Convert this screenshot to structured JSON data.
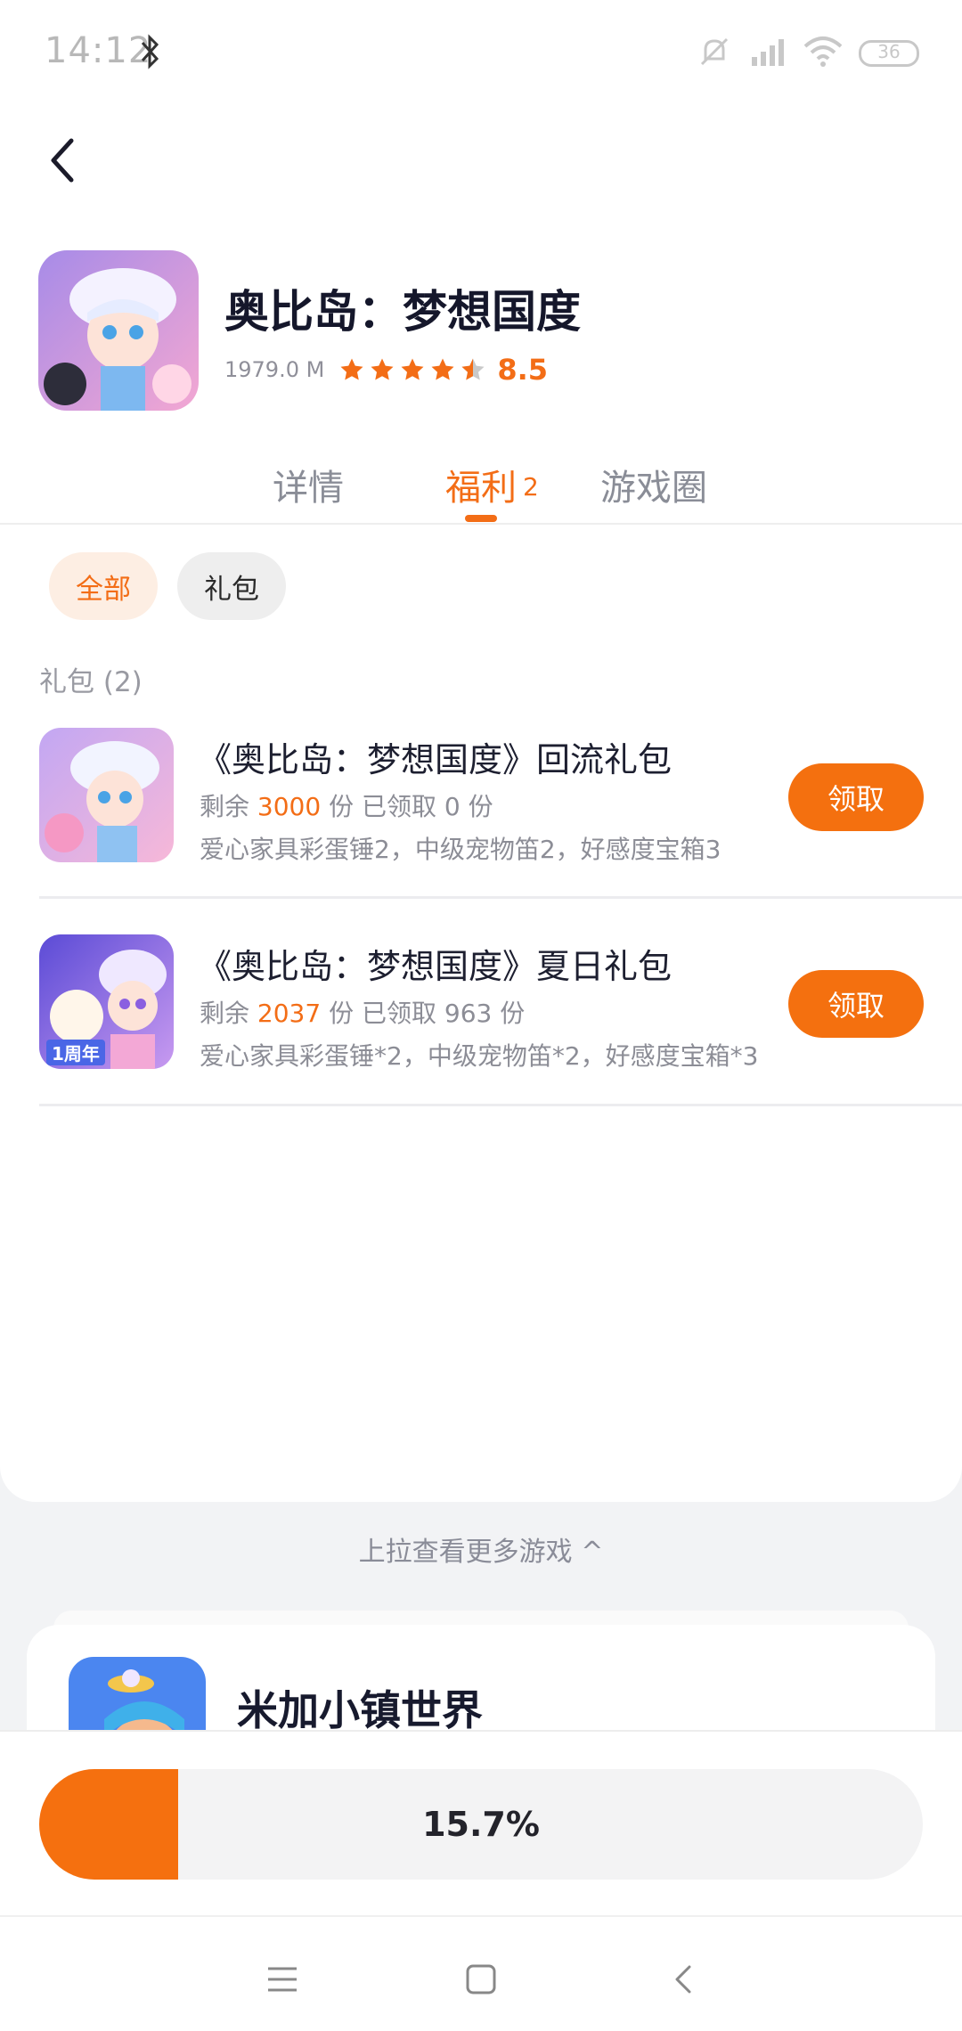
{
  "status_bar": {
    "time": "14:12",
    "battery": "36"
  },
  "app": {
    "title": "奥比岛：梦想国度",
    "size": "1979.0 M",
    "rating": "8.5",
    "stars": 4.5,
    "colors": {
      "accent": "#f36d16"
    }
  },
  "tabs": [
    {
      "label": "详情"
    },
    {
      "label": "福利",
      "count": "2"
    },
    {
      "label": "游戏圈"
    }
  ],
  "filters": [
    {
      "label": "全部"
    },
    {
      "label": "礼包"
    }
  ],
  "section_title": "礼包 (2)",
  "gifts": [
    {
      "title": "《奥比岛：梦想国度》回流礼包",
      "remaining_label": "剩余",
      "remaining": "3000",
      "claimed_text": "份 已领取 0 份",
      "description": "爱心家具彩蛋锤2，中级宠物笛2，好感度宝箱3",
      "button": "领取"
    },
    {
      "title": "《奥比岛：梦想国度》夏日礼包",
      "remaining_label": "剩余",
      "remaining": "2037",
      "claimed_text": "份 已领取 963 份",
      "description": "爱心家具彩蛋锤*2，中级宠物笛*2，好感度宝箱*3",
      "button": "领取",
      "icon_badge": "1周年"
    }
  ],
  "pull_hint": "上拉查看更多游戏 ^",
  "next_game": {
    "title": "米加小镇世界"
  },
  "progress": {
    "value": 0.157,
    "label": "15.7%"
  }
}
